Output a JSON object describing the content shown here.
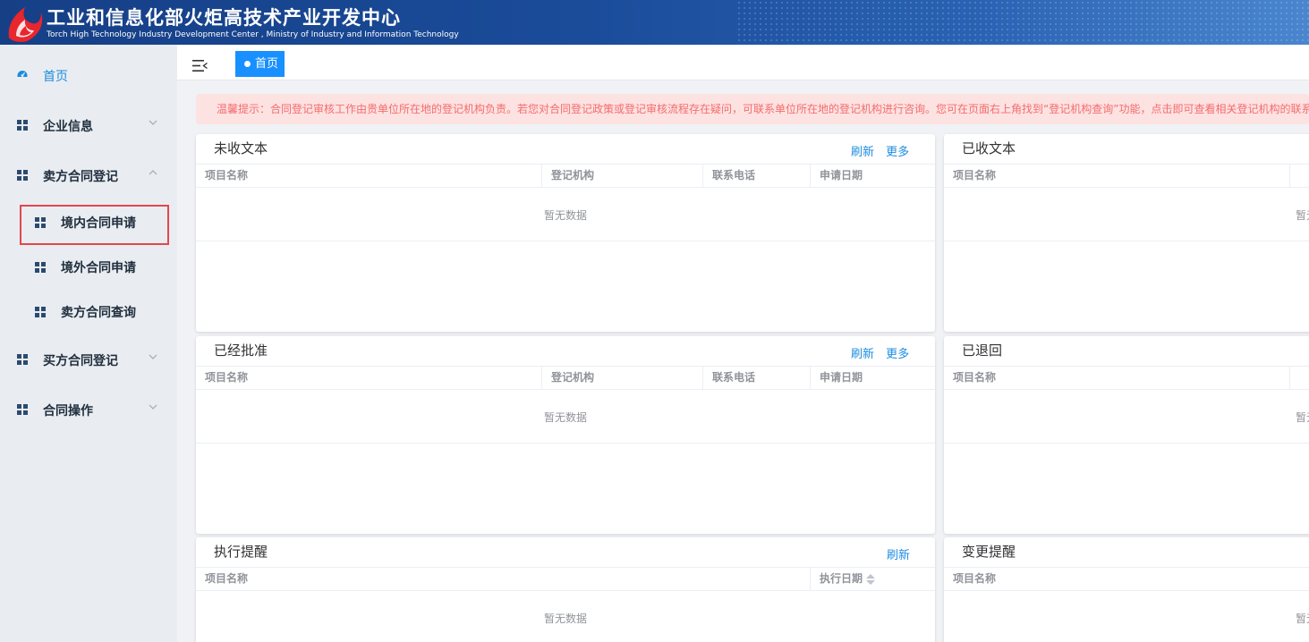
{
  "header": {
    "title": "工业和信息化部火炬高技术产业开发中心",
    "subtitle": "Torch High Technology Industry Development Center , Ministry of Industry and Information Technology"
  },
  "sidebar": {
    "home": "首页",
    "items": [
      {
        "label": "企业信息",
        "chevron": "down"
      },
      {
        "label": "卖方合同登记",
        "chevron": "up"
      },
      {
        "label": "买方合同登记",
        "chevron": "down"
      },
      {
        "label": "合同操作",
        "chevron": "down"
      }
    ],
    "sub_items": [
      {
        "label": "境内合同申请"
      },
      {
        "label": "境外合同申请"
      },
      {
        "label": "卖方合同查询"
      }
    ]
  },
  "tabs": {
    "active": "首页"
  },
  "notice": "温馨提示：合同登记审核工作由贵单位所在地的登记机构负责。若您对合同登记政策或登记审核流程存在疑问，可联系单位所在地的登记机构进行咨询。您可在页面右上角找到“登记机构查询”功能，点击即可查看相关登记机构的联系",
  "actions": {
    "refresh": "刷新",
    "more": "更多"
  },
  "columns": {
    "name": "项目名称",
    "org": "登记机构",
    "phone": "联系电话",
    "date": "申请日期",
    "exec_date": "执行日期"
  },
  "empty_text": "暂无数据",
  "panels": {
    "unreceived": {
      "title": "未收文本"
    },
    "received": {
      "title": "已收文本"
    },
    "approved": {
      "title": "已经批准"
    },
    "returned": {
      "title": "已退回"
    },
    "execution": {
      "title": "执行提醒"
    },
    "change": {
      "title": "变更提醒"
    }
  },
  "colors": {
    "brand_blue": "#1a4c9a",
    "accent": "#1890ff",
    "link": "#1d8ce0",
    "notice_bg": "#fde2e2",
    "notice_text": "#f56c6c",
    "highlight": "#e4474b"
  }
}
